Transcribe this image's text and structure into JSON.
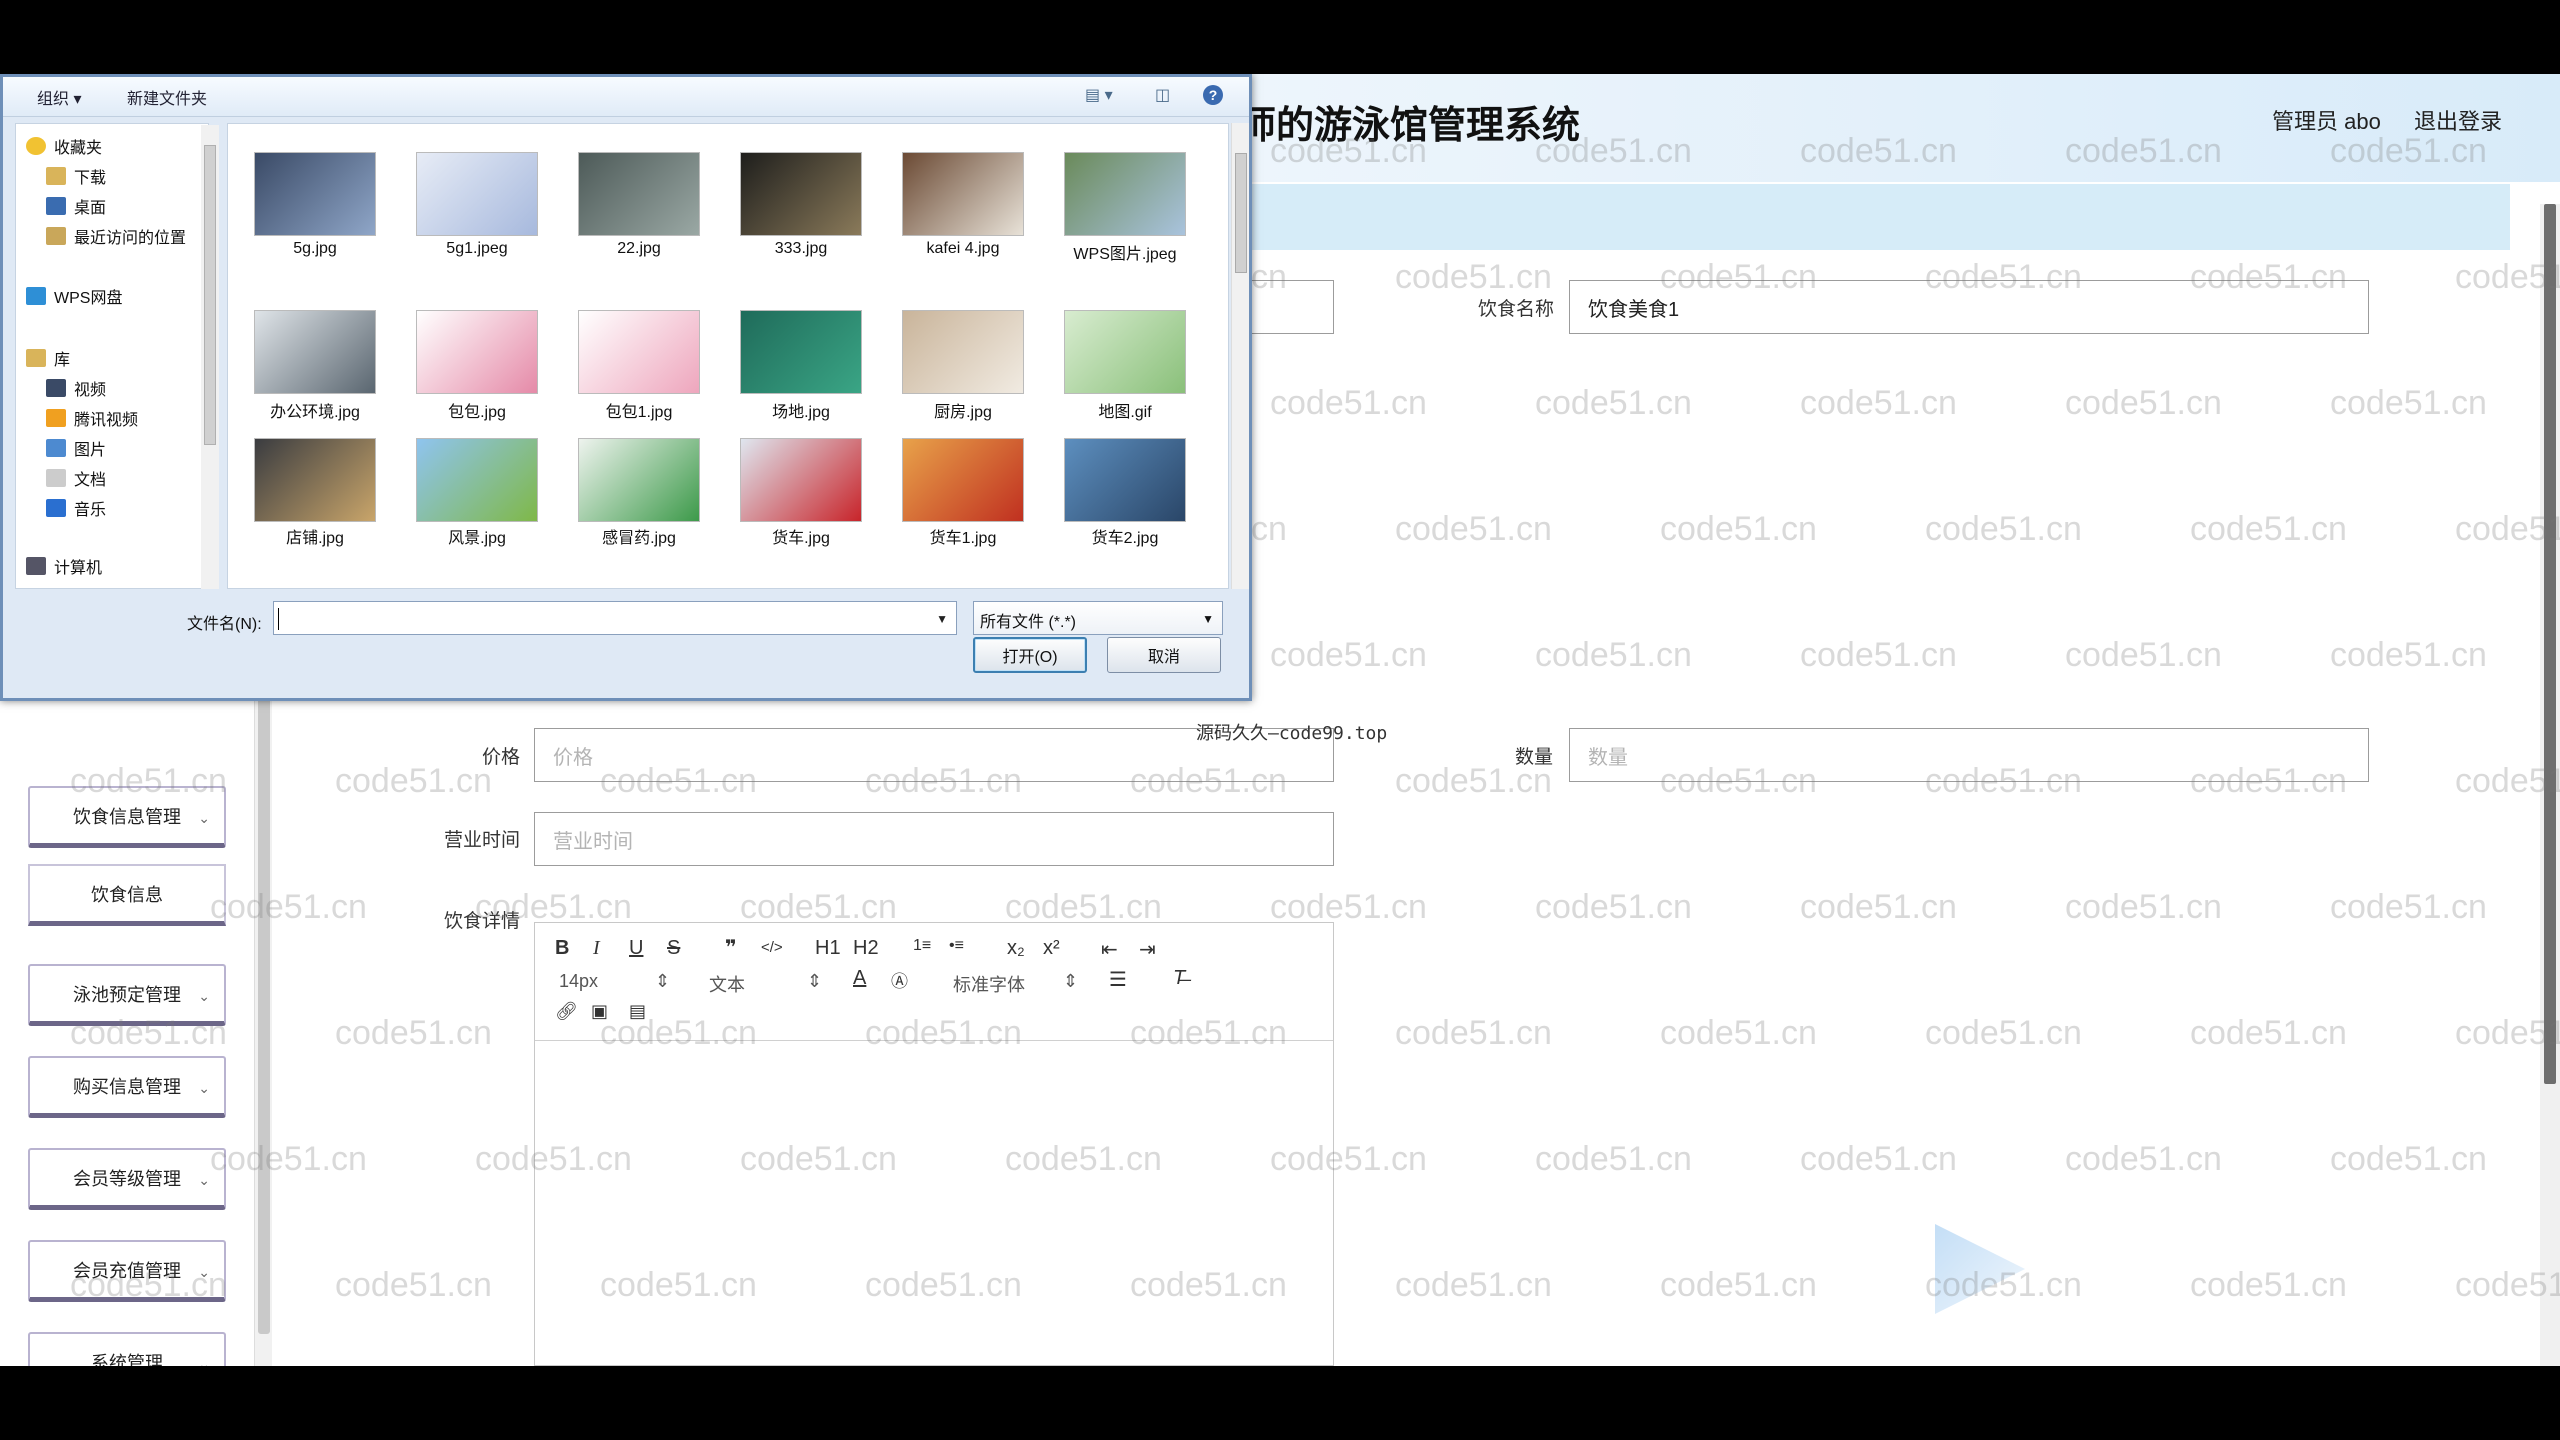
{
  "page": {
    "title": "师的游泳馆管理系统",
    "admin": "管理员 abo",
    "logout": "退出登录",
    "overlay": "源码久久—code99.top",
    "watermark": "code51.cn"
  },
  "sidebar": {
    "items": [
      {
        "label": "饮食信息管理"
      },
      {
        "label": "饮食信息"
      },
      {
        "label": "泳池预定管理"
      },
      {
        "label": "购买信息管理"
      },
      {
        "label": "会员等级管理"
      },
      {
        "label": "会员充值管理"
      },
      {
        "label": "系统管理"
      }
    ]
  },
  "form": {
    "food_name_label": "饮食名称",
    "food_name_value": "饮食美食1",
    "price_label": "价格",
    "price_placeholder": "价格",
    "qty_label": "数量",
    "qty_placeholder": "数量",
    "hours_label": "营业时间",
    "hours_placeholder": "营业时间",
    "detail_label": "饮食详情"
  },
  "editor": {
    "font_size": "14px",
    "block_type": "文本",
    "font_family": "标准字体",
    "buttons": [
      "B",
      "I",
      "U",
      "S",
      "❞",
      "</>",
      "H1",
      "H2",
      "1≡",
      "•≡",
      "x₂",
      "x²",
      "⇤",
      "⇥"
    ]
  },
  "dialog": {
    "toolbar": {
      "organize": "组织 ▾",
      "new_folder": "新建文件夹"
    },
    "nav": [
      {
        "label": "收藏夹",
        "icon": "star-icon"
      },
      {
        "label": "下载",
        "icon": "download-folder-icon"
      },
      {
        "label": "桌面",
        "icon": "desktop-icon"
      },
      {
        "label": "最近访问的位置",
        "icon": "recent-places-icon"
      },
      {
        "label": "WPS网盘",
        "icon": "cloud-icon"
      },
      {
        "label": "库",
        "icon": "library-icon"
      },
      {
        "label": "视频",
        "icon": "video-icon"
      },
      {
        "label": "腾讯视频",
        "icon": "tencent-video-icon"
      },
      {
        "label": "图片",
        "icon": "pictures-icon"
      },
      {
        "label": "文档",
        "icon": "documents-icon"
      },
      {
        "label": "音乐",
        "icon": "music-icon"
      },
      {
        "label": "计算机",
        "icon": "computer-icon"
      }
    ],
    "files": [
      {
        "name": "5g.jpg",
        "c1": "#3a4a66",
        "c2": "#8fa6c8"
      },
      {
        "name": "5g1.jpeg",
        "c1": "#e7ecf6",
        "c2": "#a7b9dd"
      },
      {
        "name": "22.jpg",
        "c1": "#4d5a58",
        "c2": "#9aa8a4"
      },
      {
        "name": "333.jpg",
        "c1": "#1e1e1c",
        "c2": "#8a7a5a"
      },
      {
        "name": "kafei 4.jpg",
        "c1": "#6b4a34",
        "c2": "#e8e2d8"
      },
      {
        "name": "WPS图片.jpeg",
        "c1": "#6a8a5a",
        "c2": "#a9c3dd"
      },
      {
        "name": "办公环境.jpg",
        "c1": "#dfe4e8",
        "c2": "#5a6670"
      },
      {
        "name": "包包.jpg",
        "c1": "#ffffff",
        "c2": "#e58aa8"
      },
      {
        "name": "包包1.jpg",
        "c1": "#ffffff",
        "c2": "#eea6bd"
      },
      {
        "name": "场地.jpg",
        "c1": "#1f6b5a",
        "c2": "#3aa585"
      },
      {
        "name": "厨房.jpg",
        "c1": "#c9b49a",
        "c2": "#f1ebe2"
      },
      {
        "name": "地图.gif",
        "c1": "#d8ecd0",
        "c2": "#8ac07a"
      },
      {
        "name": "店铺.jpg",
        "c1": "#3a3c40",
        "c2": "#c9a56a"
      },
      {
        "name": "风景.jpg",
        "c1": "#8fc4ef",
        "c2": "#7fb848"
      },
      {
        "name": "感冒药.jpg",
        "c1": "#eef3ee",
        "c2": "#3d9a4a"
      },
      {
        "name": "货车.jpg",
        "c1": "#dfe6ef",
        "c2": "#c8242a"
      },
      {
        "name": "货车1.jpg",
        "c1": "#e8a24a",
        "c2": "#c03020"
      },
      {
        "name": "货车2.jpg",
        "c1": "#5d8fbf",
        "c2": "#2a4668"
      }
    ],
    "filename_label": "文件名(N):",
    "filename_value": "",
    "filter": "所有文件 (*.*)",
    "open": "打开(O)",
    "cancel": "取消"
  }
}
